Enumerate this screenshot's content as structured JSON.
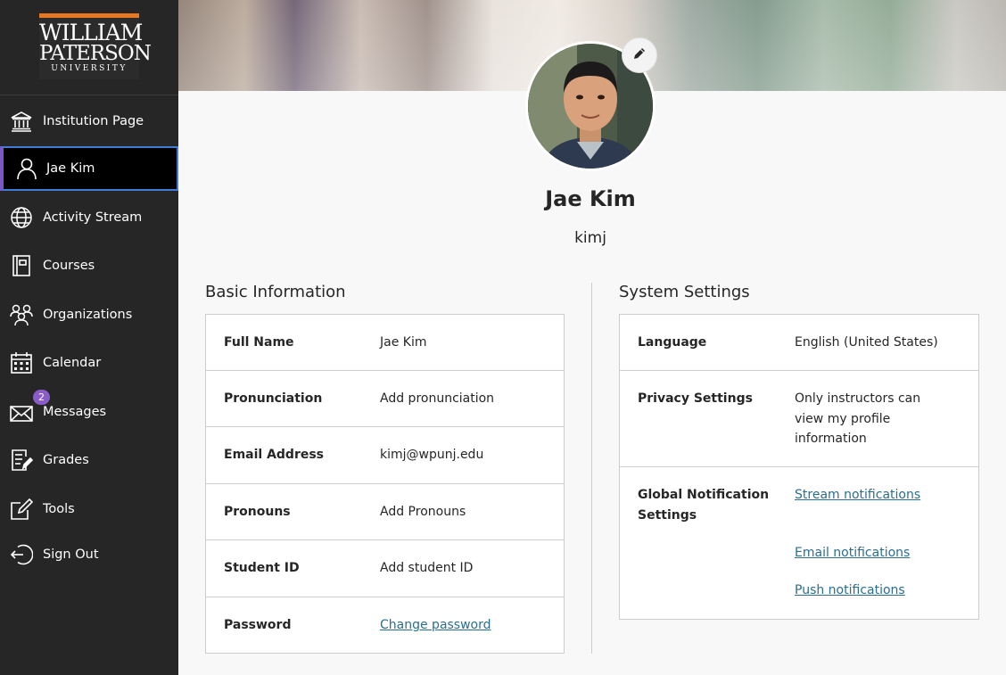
{
  "sidebar": {
    "logo": {
      "line1": "WILLIAM",
      "line2": "PATERSON",
      "line3": "UNIVERSITY"
    },
    "items": [
      {
        "label": "Institution Page",
        "icon": "institution-icon"
      },
      {
        "label": "Jae Kim",
        "icon": "user-icon"
      },
      {
        "label": "Activity Stream",
        "icon": "globe-icon"
      },
      {
        "label": "Courses",
        "icon": "book-icon"
      },
      {
        "label": "Organizations",
        "icon": "organizations-icon"
      },
      {
        "label": "Calendar",
        "icon": "calendar-icon"
      },
      {
        "label": "Messages",
        "icon": "envelope-icon",
        "badge": "2"
      },
      {
        "label": "Grades",
        "icon": "grades-icon"
      },
      {
        "label": "Tools",
        "icon": "tools-icon"
      },
      {
        "label": "Sign Out",
        "icon": "sign-out-icon"
      }
    ]
  },
  "profile": {
    "name": "Jae Kim",
    "username": "kimj"
  },
  "basic_info": {
    "title": "Basic Information",
    "rows": [
      {
        "label": "Full Name",
        "value": "Jae Kim"
      },
      {
        "label": "Pronunciation",
        "value": "Add pronunciation"
      },
      {
        "label": "Email Address",
        "value": "kimj@wpunj.edu"
      },
      {
        "label": "Pronouns",
        "value": "Add Pronouns"
      },
      {
        "label": "Student ID",
        "value": "Add student ID"
      },
      {
        "label": "Password",
        "value": "Change password"
      }
    ]
  },
  "system_settings": {
    "title": "System Settings",
    "language_label": "Language",
    "language_value": "English (United States)",
    "privacy_label": "Privacy Settings",
    "privacy_line1": "Only instructors can",
    "privacy_line2": "view my profile",
    "privacy_line3": "information",
    "notif_label_line1": "Global Notification",
    "notif_label_line2": "Settings",
    "stream_notifications": "Stream notifications",
    "email_notifications": "Email notifications",
    "push_notifications": "Push notifications"
  },
  "colors": {
    "sidebar_bg": "#262626",
    "accent_orange": "#e87722",
    "active_border": "#3e7cd6",
    "badge": "#8a5cc9",
    "link": "#2a6e8f"
  }
}
